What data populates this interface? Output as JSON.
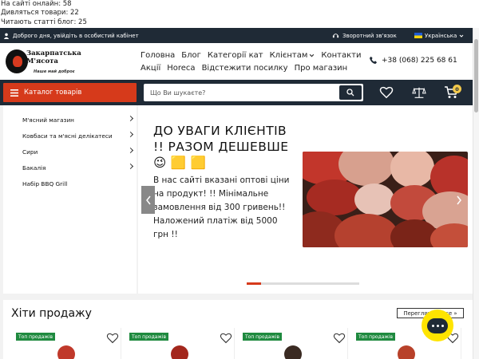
{
  "stats": {
    "online": "На сайті онлайн: 58",
    "viewing": "Дивляться товари: 22",
    "reading": "Читають статті блог: 25"
  },
  "topbar": {
    "login": "Доброго дня, увійдіть в особистий кабінет",
    "callback": "Зворотний зв'язок",
    "language": "Українська"
  },
  "logo": {
    "line1": "Закарпатська",
    "line2": "М'ясота",
    "slogan": "Наше май доброє"
  },
  "nav": {
    "row1": [
      "Головна",
      "Блог",
      "Категорії кат",
      "Клієнтам",
      "Контакти"
    ],
    "row2": [
      "Акції",
      "Horeca",
      "Відстежити посилку",
      "Про магазин"
    ]
  },
  "phone": "+38 (068) 225 68 61",
  "catalog_label": "Каталог товарів",
  "search": {
    "placeholder": "Що Ви шукаєте?"
  },
  "cart_count": "0",
  "sidebar": [
    "М'ясний магазин",
    "Ковбаси та м'ясні делікатеси",
    "Сири",
    "Бакалія",
    "Набір BBQ Grill"
  ],
  "slide": {
    "headline": "ДО УВАГИ КЛІЄНТІВ !! РАЗОМ ДЕШЕВШЕ 😉 🟨 🟨",
    "body": "В нас сайті вказані оптові ціни на продукт! !! Мінімальне замовлення від 300 гривень!! Наложений платіж від 5000 грн !!"
  },
  "hits": {
    "title": "Хіти продажу",
    "view_all": "Переглянути все »",
    "badge": "Топ продажів",
    "card_count": 4
  },
  "colors": {
    "dark": "#1f2a36",
    "accent": "#d63a1b",
    "badge": "#1f8a3f",
    "chat": "#ffe400"
  }
}
